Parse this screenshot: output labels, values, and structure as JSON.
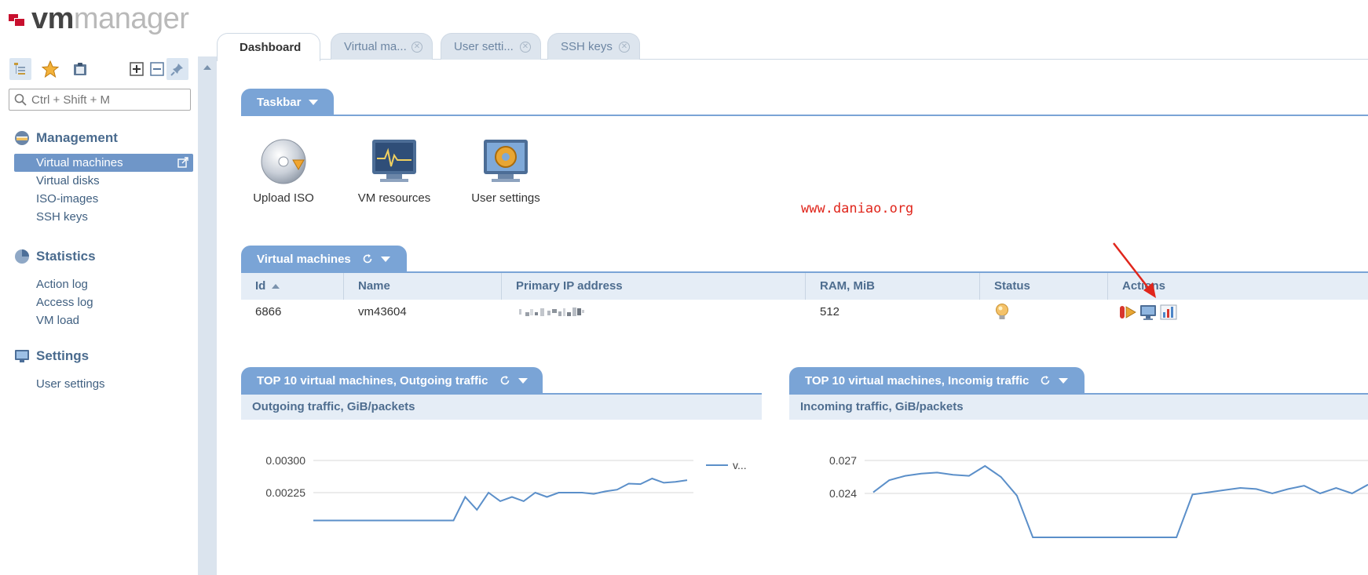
{
  "app": {
    "logo_part1": "vm",
    "logo_part2": "manager"
  },
  "search": {
    "placeholder": "Ctrl + Shift + M"
  },
  "nav": [
    {
      "title": "Management",
      "items": [
        "Virtual machines",
        "Virtual disks",
        "ISO-images",
        "SSH keys"
      ]
    },
    {
      "title": "Statistics",
      "items": [
        "Action log",
        "Access log",
        "VM load"
      ]
    },
    {
      "title": "Settings",
      "items": [
        "User settings"
      ]
    }
  ],
  "tabs": [
    "Dashboard",
    "Virtual ma...",
    "User setti...",
    "SSH keys"
  ],
  "taskbar": {
    "title": "Taskbar",
    "items": [
      "Upload ISO",
      "VM resources",
      "User settings"
    ]
  },
  "watermark": "www.daniao.org",
  "vm_section": {
    "title": "Virtual machines",
    "columns": [
      "Id",
      "Name",
      "Primary IP address",
      "RAM, MiB",
      "Status",
      "Actions"
    ],
    "rows": [
      {
        "id": "6866",
        "name": "vm43604",
        "ram": "512",
        "status": "bulb-icon"
      }
    ]
  },
  "outgoing": {
    "title": "TOP 10 virtual machines, Outgoing traffic",
    "subtitle": "Outgoing traffic, GiB/packets",
    "legend": "v..."
  },
  "incoming": {
    "title": "TOP 10 virtual machines, Incomig traffic",
    "subtitle": "Incoming traffic, GiB/packets"
  },
  "colors": {
    "accent": "#7aa4d6",
    "selected": "#6f96c8",
    "line": "#5b8fc9",
    "watermark": "#e0261c"
  },
  "chart_data": [
    {
      "type": "line",
      "yticks": [
        "0.00300",
        "0.00225"
      ],
      "ylim": [
        0.0015,
        0.003
      ],
      "series": [
        {
          "name": "v...",
          "values": [
            0.0016,
            0.0016,
            0.0016,
            0.0016,
            0.0016,
            0.0016,
            0.0016,
            0.0016,
            0.0016,
            0.0016,
            0.0016,
            0.0016,
            0.0016,
            0.00215,
            0.00185,
            0.00225,
            0.00205,
            0.00215,
            0.00205,
            0.00225,
            0.00215,
            0.00225,
            0.00225,
            0.00225,
            0.00222,
            0.00228,
            0.00232,
            0.00246,
            0.00245,
            0.00258,
            0.00248,
            0.0025,
            0.00254
          ]
        }
      ]
    },
    {
      "type": "line",
      "yticks": [
        "0.027",
        "0.024"
      ],
      "ylim": [
        0.02,
        0.027
      ],
      "series": [
        {
          "values": [
            0.0241,
            0.0252,
            0.0256,
            0.0258,
            0.0259,
            0.0257,
            0.0256,
            0.0265,
            0.0255,
            0.0238,
            0.02,
            0.02,
            0.02,
            0.02,
            0.02,
            0.02,
            0.02,
            0.02,
            0.02,
            0.02,
            0.0239,
            0.0241,
            0.0243,
            0.0245,
            0.0244,
            0.024,
            0.0244,
            0.0247,
            0.024,
            0.0245,
            0.024,
            0.0248
          ]
        }
      ]
    }
  ]
}
